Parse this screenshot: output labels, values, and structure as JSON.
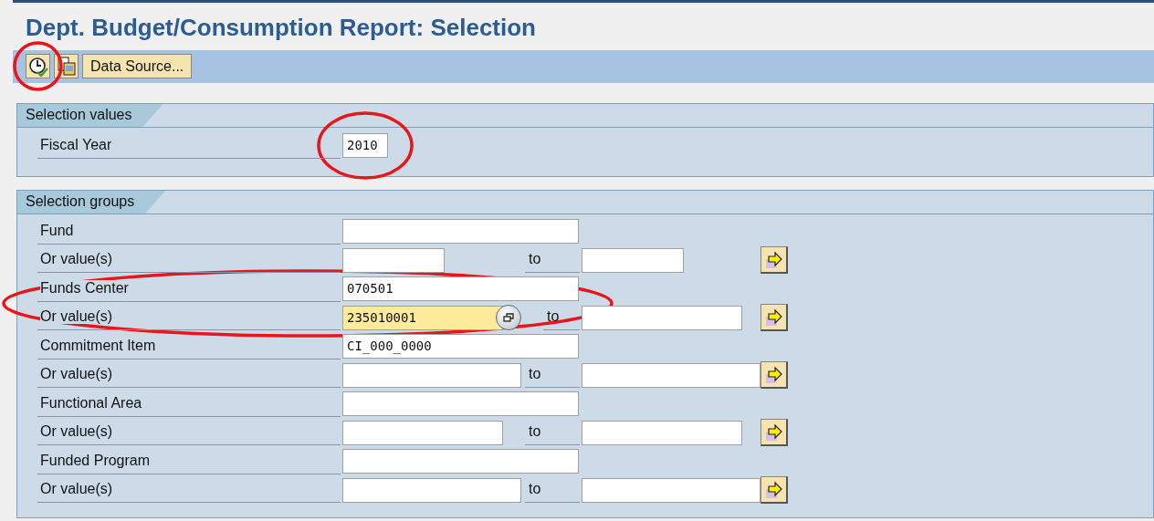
{
  "title": "Dept. Budget/Consumption Report: Selection",
  "toolbar": [
    {
      "kind": "execute",
      "circled": true
    },
    {
      "kind": "copy"
    },
    {
      "kind": "text",
      "label": "Data Source..."
    }
  ],
  "selection_values": {
    "title": "Selection values",
    "fields": [
      {
        "label": "Fiscal Year",
        "value": "2010",
        "circled": true
      }
    ]
  },
  "selection_groups": {
    "title": "Selection groups",
    "rows": [
      {
        "kind": "single",
        "label": "Fund"
      },
      {
        "kind": "range",
        "label": "Or value(s)",
        "to_label": "to"
      },
      {
        "kind": "single",
        "label": "Funds Center",
        "value": "070501",
        "circled": true
      },
      {
        "kind": "range",
        "label": "Or value(s)",
        "value": "235010001",
        "to_label": "to",
        "circled": true,
        "focused": true
      },
      {
        "kind": "single",
        "label": "Commitment Item",
        "value": "CI_000_0000"
      },
      {
        "kind": "range",
        "label": "Or value(s)",
        "to_label": "to"
      },
      {
        "kind": "single",
        "label": "Functional Area"
      },
      {
        "kind": "range",
        "label": "Or value(s)",
        "to_label": "to"
      },
      {
        "kind": "single",
        "label": "Funded Program"
      },
      {
        "kind": "range",
        "label": "Or value(s)",
        "to_label": "to"
      }
    ]
  }
}
